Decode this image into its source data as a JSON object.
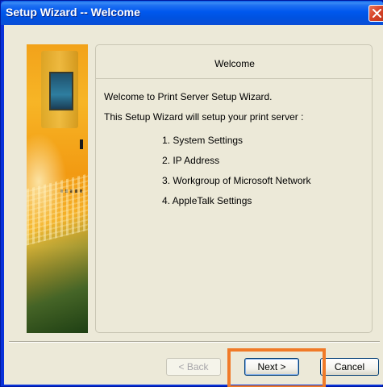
{
  "window": {
    "title": "Setup Wizard -- Welcome",
    "close_icon": "close-icon"
  },
  "panel": {
    "title": "Welcome",
    "intro_line1": "Welcome to Print Server Setup Wizard.",
    "intro_line2": "This Setup Wizard will setup your print server :",
    "steps": [
      "1. System Settings",
      "2. IP Address",
      "3. Workgroup of Microsoft Network",
      "4. AppleTalk Settings"
    ]
  },
  "buttons": {
    "back_label": "< Back",
    "next_label": "Next >",
    "cancel_label": "Cancel"
  },
  "colors": {
    "title_bar": "#0058ee",
    "dialog_bg": "#ece9d8",
    "highlight": "#f07a28",
    "close_button": "#d8452a"
  }
}
